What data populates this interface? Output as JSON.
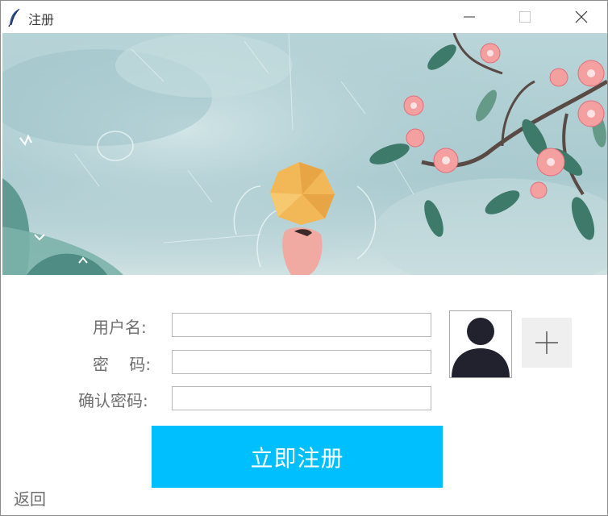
{
  "window": {
    "title": "注册",
    "minimize_icon": "minimize-icon",
    "maximize_icon": "maximize-icon",
    "close_icon": "close-icon"
  },
  "banner": {
    "description_icon": "banner-illustration"
  },
  "form": {
    "username_label": "用户名:",
    "password_label": "密    码:",
    "confirm_label": "确认密码:",
    "username_value": "",
    "password_value": "",
    "confirm_value": ""
  },
  "avatar": {
    "icon": "user-silhouette-icon",
    "add_icon": "plus-icon"
  },
  "actions": {
    "register_label": "立即注册",
    "back_label": "返回"
  },
  "colors": {
    "accent": "#00bfff",
    "label": "#6e6e6e",
    "avatar": "#22222e"
  }
}
